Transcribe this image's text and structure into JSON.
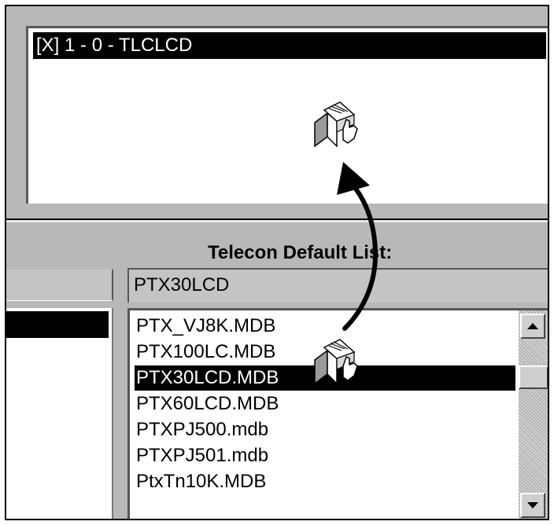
{
  "window": {
    "selected_entry": "[X] 1 - 0 - TLCLCD"
  },
  "telecon": {
    "list_label": "Telecon Default List:",
    "name_field_value": "PTX30LCD",
    "items": [
      {
        "label": "PTX_VJ8K.MDB",
        "selected": false
      },
      {
        "label": "PTX100LC.MDB",
        "selected": false
      },
      {
        "label": "PTX30LCD.MDB",
        "selected": true
      },
      {
        "label": "PTX60LCD.MDB",
        "selected": false
      },
      {
        "label": "PTXPJ500.mdb",
        "selected": false
      },
      {
        "label": "PTXPJ501.mdb",
        "selected": false
      },
      {
        "label": "PtxTn10K.MDB",
        "selected": false
      }
    ]
  },
  "icons": {
    "drag_cursor": "drag-document-hand-icon",
    "drop_cursor": "drop-document-hand-icon",
    "drag_arrow": "curved-arrow-up-icon",
    "scroll_up": "scroll-up-arrow-icon",
    "scroll_down": "scroll-down-arrow-icon"
  },
  "colors": {
    "selection_bg": "#000000",
    "panel_bg": "#b8b8b8",
    "field_bg": "#c4c4c4"
  }
}
